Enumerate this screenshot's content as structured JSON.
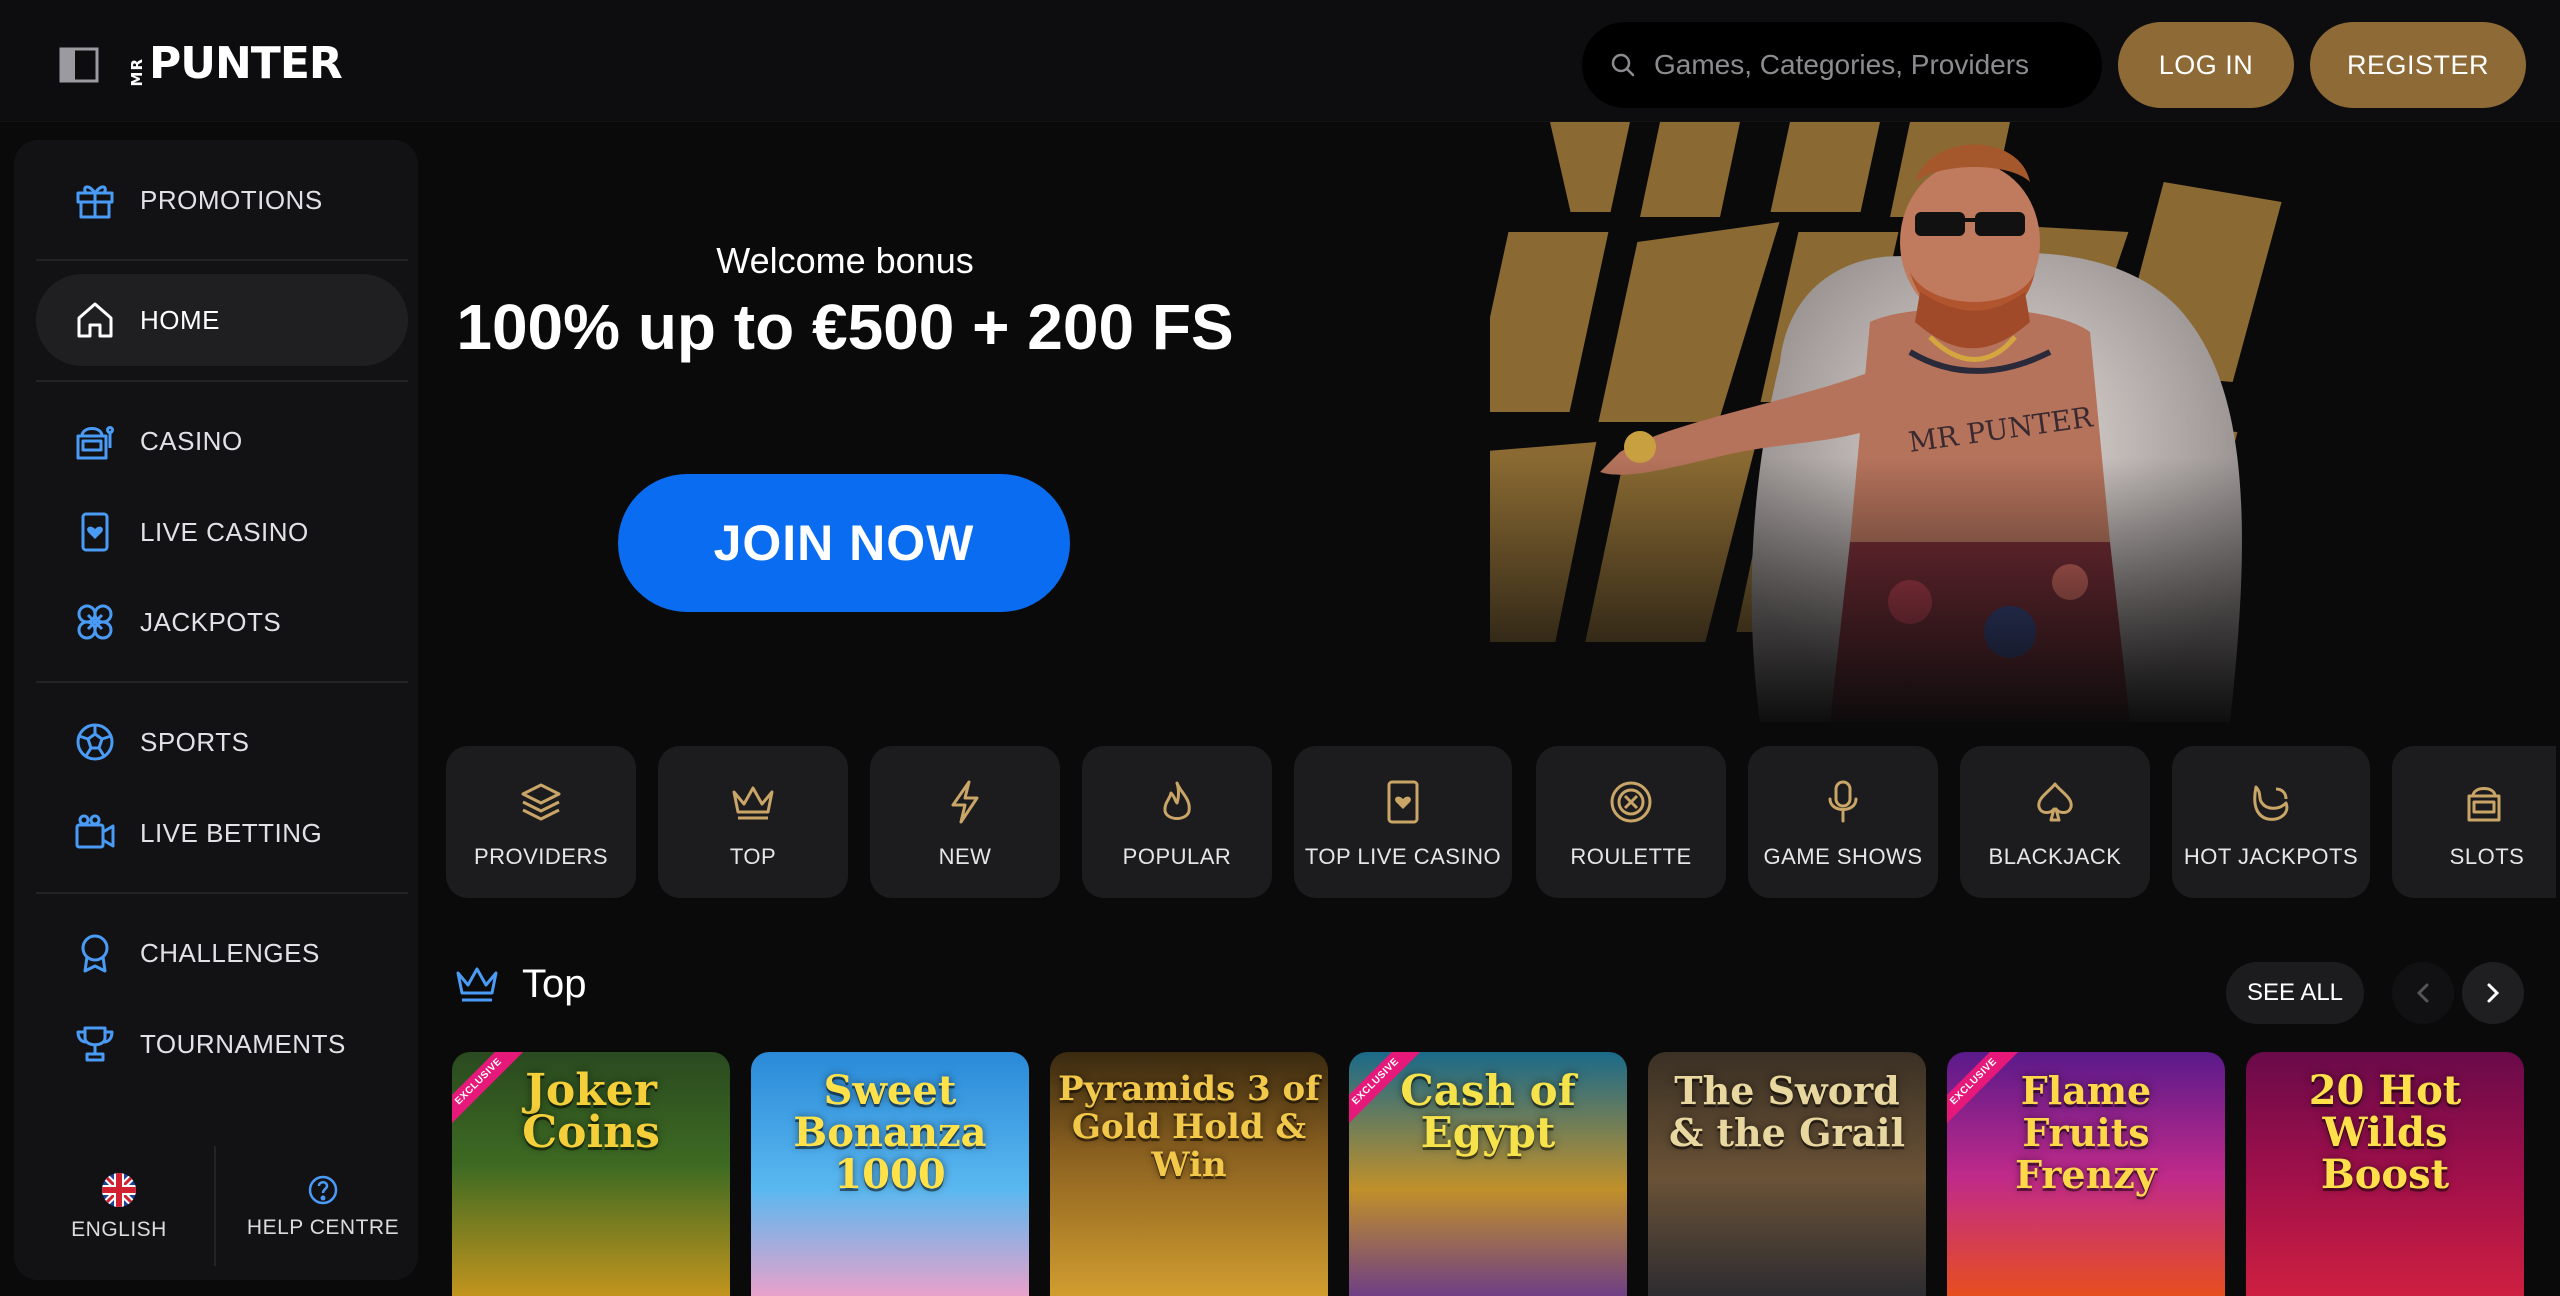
{
  "header": {
    "logo_small": "MR",
    "logo_main": "PUNTER",
    "search_placeholder": "Games, Categories, Providers",
    "login_label": "LOG IN",
    "register_label": "REGISTER"
  },
  "sidebar": {
    "items": [
      {
        "label": "PROMOTIONS",
        "icon": "gift-icon"
      },
      {
        "label": "HOME",
        "icon": "home-icon",
        "active": true
      },
      {
        "label": "CASINO",
        "icon": "slot-machine-icon"
      },
      {
        "label": "LIVE CASINO",
        "icon": "card-heart-icon"
      },
      {
        "label": "JACKPOTS",
        "icon": "clover-icon"
      },
      {
        "label": "SPORTS",
        "icon": "soccer-ball-icon"
      },
      {
        "label": "LIVE BETTING",
        "icon": "video-camera-icon"
      },
      {
        "label": "CHALLENGES",
        "icon": "award-ribbon-icon"
      },
      {
        "label": "TOURNAMENTS",
        "icon": "trophy-icon"
      }
    ],
    "footer": {
      "language_label": "ENGLISH",
      "help_label": "HELP CENTRE"
    }
  },
  "hero": {
    "welcome": "Welcome bonus",
    "offer": "100% up to €500 + 200 FS",
    "cta": "JOIN NOW"
  },
  "categories": [
    {
      "label": "PROVIDERS",
      "icon": "layers-icon"
    },
    {
      "label": "TOP",
      "icon": "crown-icon"
    },
    {
      "label": "NEW",
      "icon": "lightning-icon"
    },
    {
      "label": "POPULAR",
      "icon": "flame-icon"
    },
    {
      "label": "TOP LIVE CASINO",
      "icon": "card-heart-icon"
    },
    {
      "label": "ROULETTE",
      "icon": "roulette-icon"
    },
    {
      "label": "GAME SHOWS",
      "icon": "microphone-icon"
    },
    {
      "label": "BLACKJACK",
      "icon": "spade-icon"
    },
    {
      "label": "HOT JACKPOTS",
      "icon": "hot-pepper-icon"
    },
    {
      "label": "SLOTS",
      "icon": "slot-machine-icon"
    }
  ],
  "section": {
    "title": "Top",
    "see_all": "SEE ALL"
  },
  "games": [
    {
      "title": "Joker Coins",
      "badge": "EXCLUSIVE"
    },
    {
      "title": "Sweet Bonanza 1000",
      "badge": ""
    },
    {
      "title": "Pyramids 3 of Gold Hold & Win",
      "badge": ""
    },
    {
      "title": "Cash of Egypt",
      "badge": "EXCLUSIVE"
    },
    {
      "title": "The Sword & the Grail",
      "badge": ""
    },
    {
      "title": "Flame Fruits Frenzy",
      "badge": "EXCLUSIVE"
    },
    {
      "title": "20 Hot Wilds Boost",
      "badge": ""
    }
  ],
  "colors": {
    "accent_gold": "#8d6a36",
    "cta_blue": "#0a6cf0",
    "nav_icon_blue": "#4a9bf5",
    "category_icon_gold": "#c9a567"
  }
}
